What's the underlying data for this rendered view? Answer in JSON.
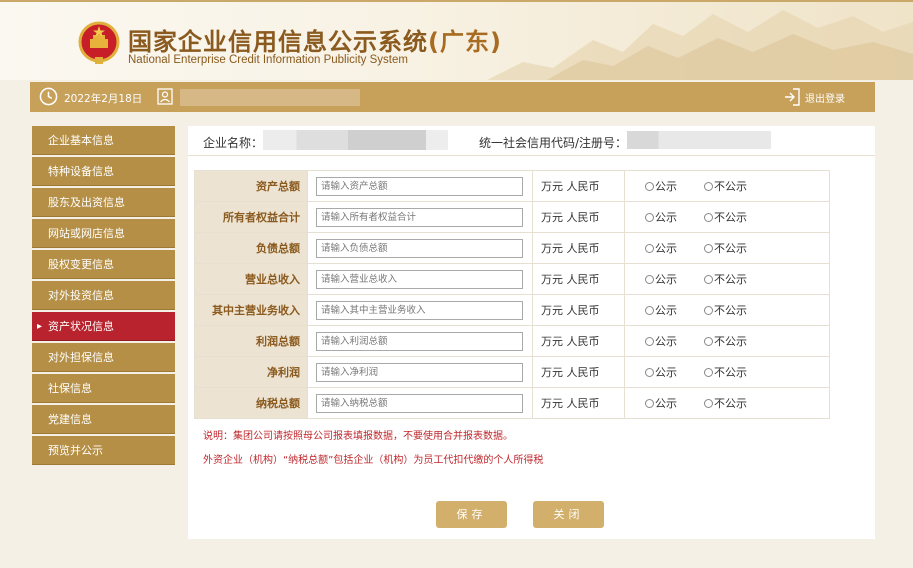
{
  "header": {
    "title_cn": "国家企业信用信息公示系统",
    "title_region": "(广东)",
    "title_en": "National Enterprise Credit Information Publicity System"
  },
  "topbar": {
    "date": "2022年2月18日",
    "logout_label": "退出登录",
    "icons": [
      "clock-icon",
      "user-icon",
      "logout-icon"
    ]
  },
  "sidebar": {
    "items": [
      {
        "label": "企业基本信息",
        "active": false
      },
      {
        "label": "特种设备信息",
        "active": false
      },
      {
        "label": "股东及出资信息",
        "active": false
      },
      {
        "label": "网站或网店信息",
        "active": false
      },
      {
        "label": "股权变更信息",
        "active": false
      },
      {
        "label": "对外投资信息",
        "active": false
      },
      {
        "label": "资产状况信息",
        "active": true
      },
      {
        "label": "对外担保信息",
        "active": false
      },
      {
        "label": "社保信息",
        "active": false
      },
      {
        "label": "党建信息",
        "active": false
      },
      {
        "label": "预览并公示",
        "active": false
      }
    ]
  },
  "info": {
    "company_name_label": "企业名称：",
    "credit_code_label": "统一社会信用代码/注册号："
  },
  "form": {
    "unit": "万元 人民币",
    "public_label": "公示",
    "private_label": "不公示",
    "rows": [
      {
        "label": "资产总额",
        "placeholder": "请输入资产总额",
        "value": ""
      },
      {
        "label": "所有者权益合计",
        "placeholder": "请输入所有者权益合计",
        "value": ""
      },
      {
        "label": "负债总额",
        "placeholder": "请输入负债总额",
        "value": ""
      },
      {
        "label": "营业总收入",
        "placeholder": "请输入营业总收入",
        "value": ""
      },
      {
        "label": "其中主营业务收入",
        "placeholder": "请输入其中主营业务收入",
        "value": ""
      },
      {
        "label": "利润总额",
        "placeholder": "请输入利润总额",
        "value": ""
      },
      {
        "label": "净利润",
        "placeholder": "请输入净利润",
        "value": ""
      },
      {
        "label": "纳税总额",
        "placeholder": "请输入纳税总额",
        "value": ""
      }
    ]
  },
  "notes": {
    "note1": "说明：集团公司请按照母公司报表填报数据，不要使用合并报表数据。",
    "note2": "外资企业（机构）“纳税总额”包括企业（机构）为员工代扣代缴的个人所得税"
  },
  "buttons": {
    "save_label": "保存",
    "close_label": "关闭"
  },
  "colors": {
    "brand": "#c7a05a",
    "active_nav": "#b8232d",
    "note": "#c0282d",
    "label": "#8a5a1e"
  }
}
